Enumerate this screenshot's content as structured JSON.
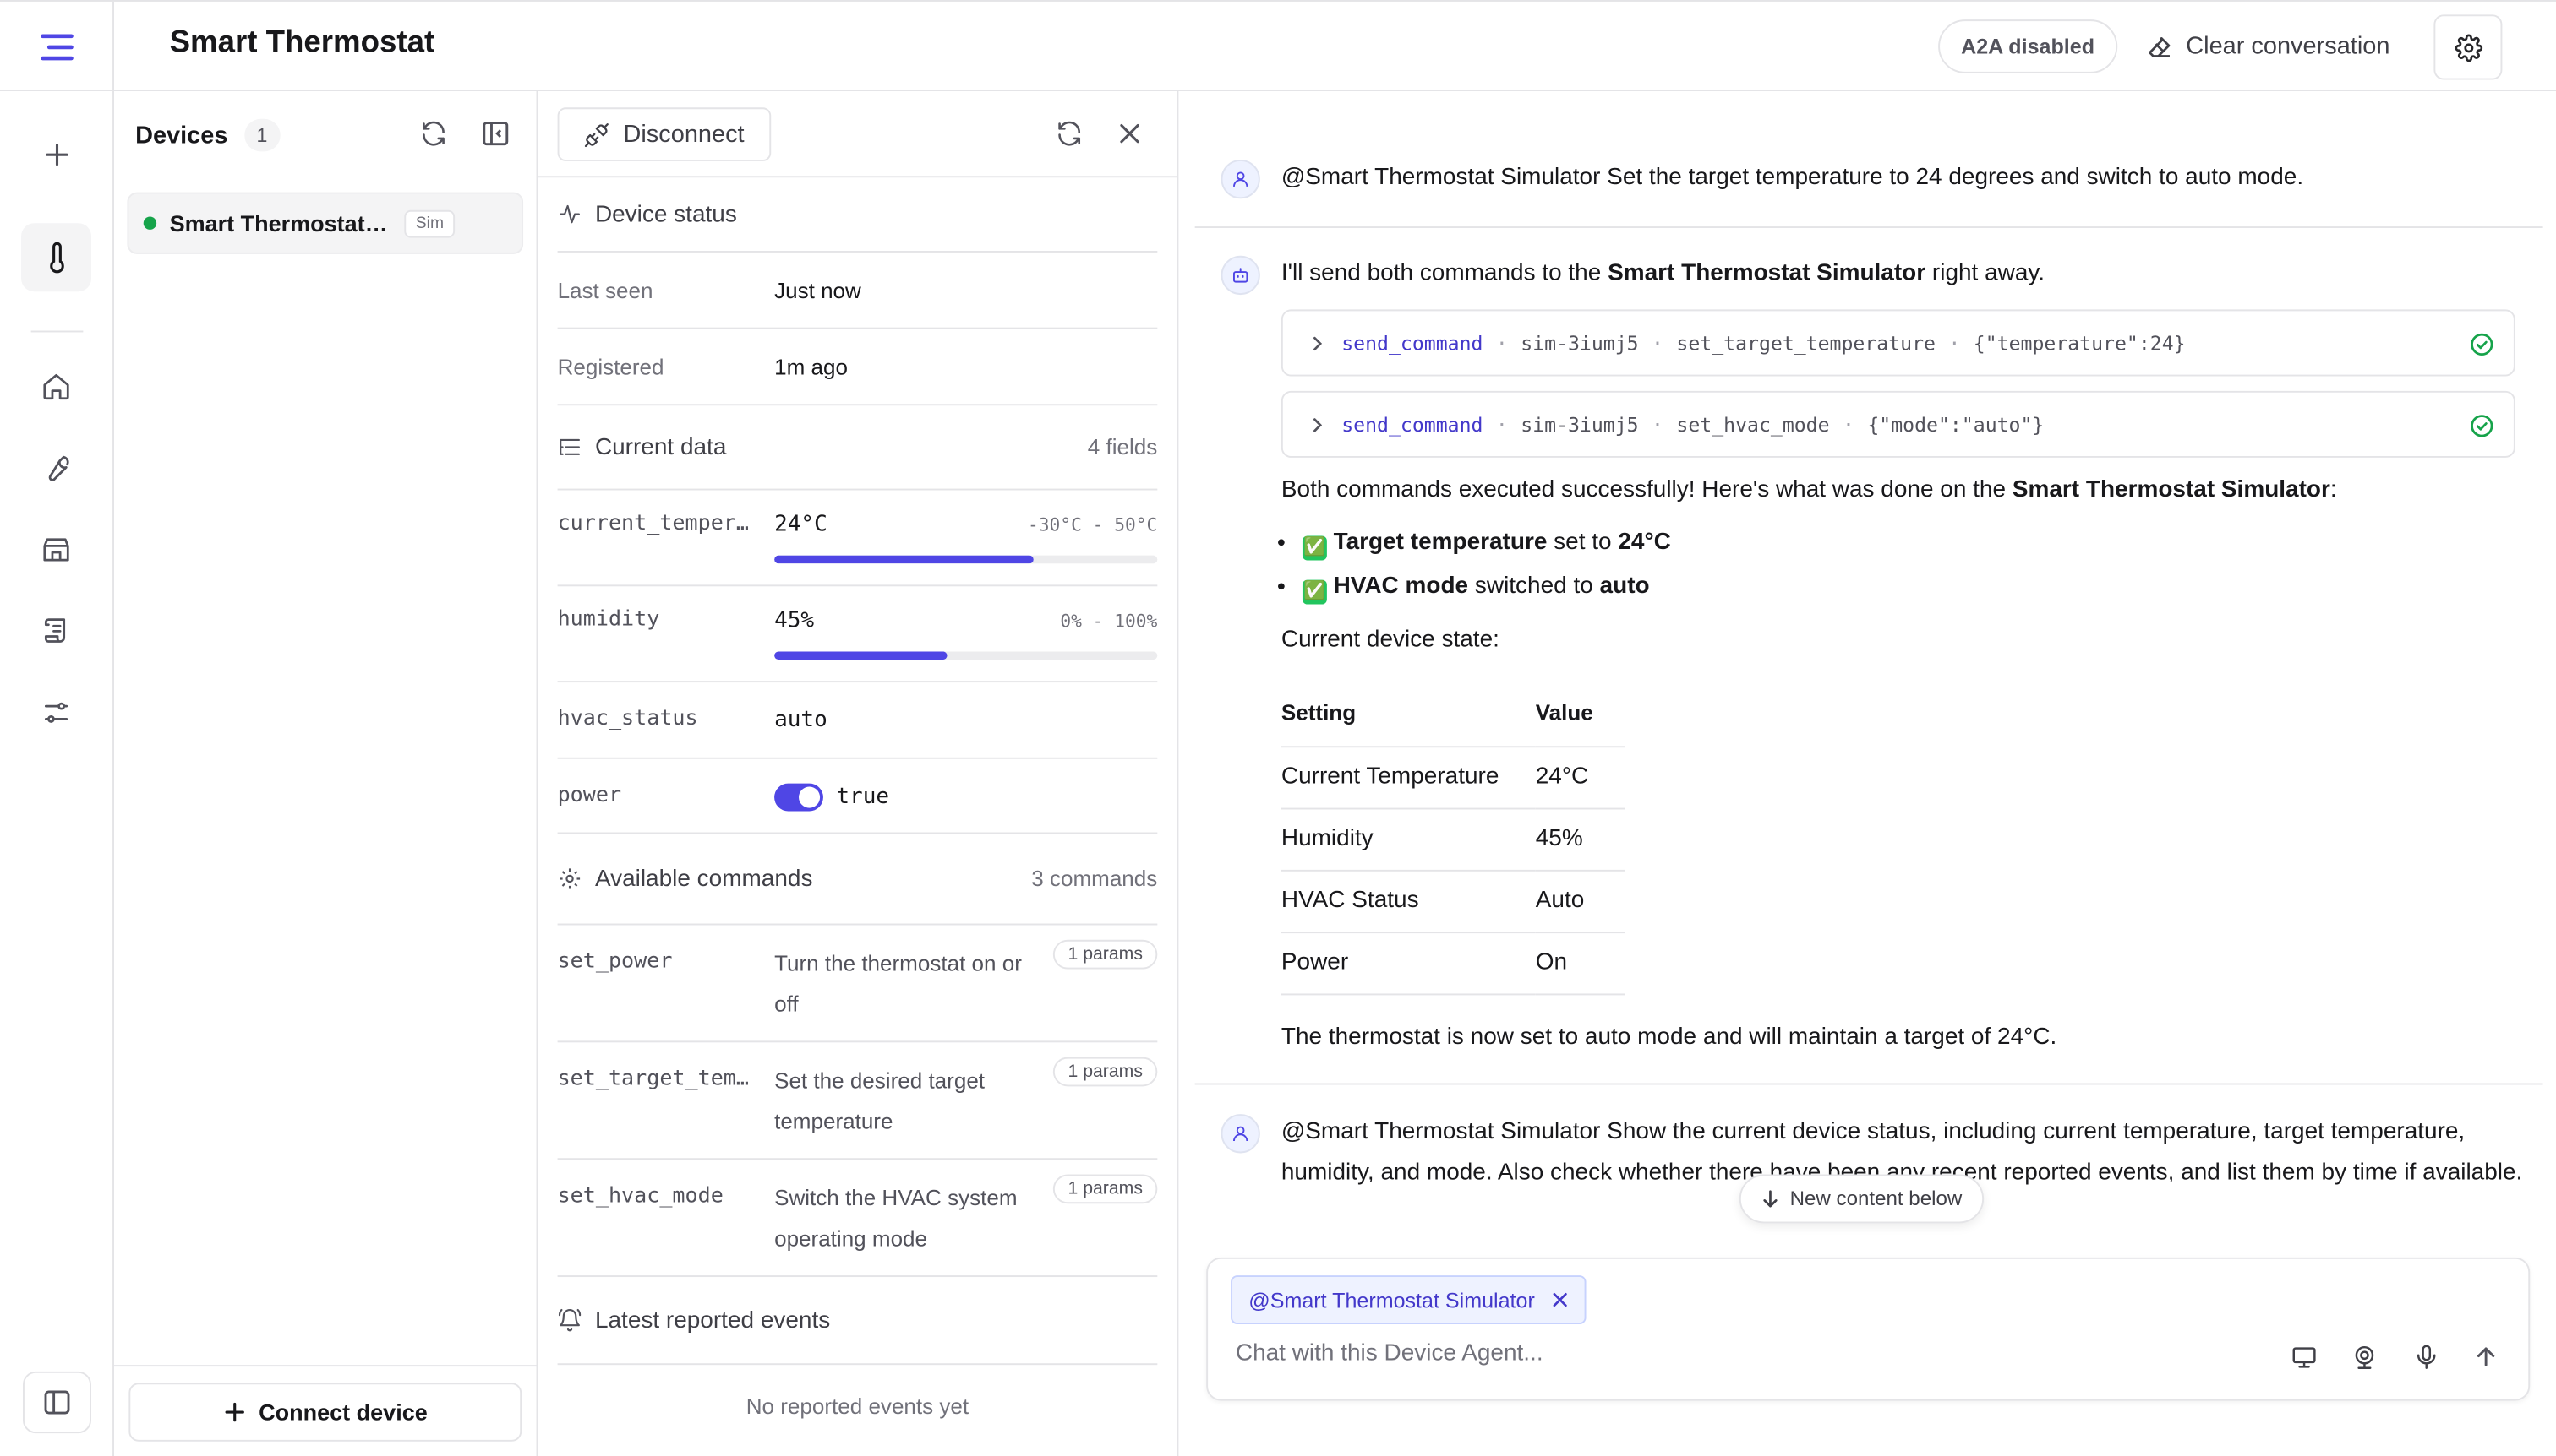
{
  "header": {
    "title": "Smart Thermostat",
    "a2a_label": "A2A disabled",
    "clear_label": "Clear conversation"
  },
  "devices_panel": {
    "title": "Devices",
    "count": "1",
    "device": {
      "name": "Smart Thermostat Simulator",
      "badge": "Sim",
      "status_color": "#16a34a"
    },
    "connect_label": "Connect device"
  },
  "detail": {
    "disconnect_label": "Disconnect",
    "device_status": {
      "title": "Device status",
      "rows": [
        {
          "label": "Last seen",
          "value": "Just now"
        },
        {
          "label": "Registered",
          "value": "1m ago"
        }
      ]
    },
    "current_data": {
      "title": "Current data",
      "meta": "4 fields",
      "fields": [
        {
          "key": "current_temperature",
          "value": "24°C",
          "range": "-30°C - 50°C",
          "level": 0.675
        },
        {
          "key": "humidity",
          "value": "45%",
          "range": "0% - 100%",
          "level": 0.45
        },
        {
          "key": "hvac_status",
          "value": "auto"
        },
        {
          "key": "power",
          "value": "true",
          "toggle_on": true
        }
      ]
    },
    "commands": {
      "title": "Available commands",
      "meta": "3 commands",
      "items": [
        {
          "name": "set_power",
          "desc": "Turn the thermostat on or off",
          "params": "1 params"
        },
        {
          "name": "set_target_temperature",
          "desc": "Set the desired target temperature",
          "params": "1 params"
        },
        {
          "name": "set_hvac_mode",
          "desc": "Switch the HVAC system operating mode",
          "params": "1 params"
        }
      ]
    },
    "events": {
      "title": "Latest reported events",
      "empty": "No reported events yet"
    }
  },
  "chat": {
    "user_msg_1": "@Smart Thermostat Simulator Set the target temperature to 24 degrees and switch to auto mode.",
    "assistant": {
      "intro_pre": "I'll send both commands to the ",
      "intro_bold": "Smart Thermostat Simulator",
      "intro_post": " right away.",
      "tool_calls": [
        {
          "fn": "send_command",
          "device": "sim-3iumj5",
          "command": "set_target_temperature",
          "args": "{\"temperature\":24}"
        },
        {
          "fn": "send_command",
          "device": "sim-3iumj5",
          "command": "set_hvac_mode",
          "args": "{\"mode\":\"auto\"}"
        }
      ],
      "summary_pre": "Both commands executed successfully! Here's what was done on the ",
      "summary_bold": "Smart Thermostat Simulator",
      "summary_post": ":",
      "bullets": [
        {
          "emoji": "✅",
          "bold": "Target temperature",
          "mid": " set to ",
          "val": "24°C"
        },
        {
          "emoji": "✅",
          "bold": "HVAC mode",
          "mid": " switched to ",
          "val": "auto"
        }
      ],
      "state_label": "Current device state:",
      "table": {
        "headers": [
          "Setting",
          "Value"
        ],
        "rows": [
          [
            "Current Temperature",
            "24°C"
          ],
          [
            "Humidity",
            "45%"
          ],
          [
            "HVAC Status",
            "Auto"
          ],
          [
            "Power",
            "On"
          ]
        ]
      },
      "closing": "The thermostat is now set to auto mode and will maintain a target of 24°C."
    },
    "user_msg_2": "@Smart Thermostat Simulator Show the current device status, including current temperature, target temperature, humidity, and mode. Also check whether there have been any recent reported events, and list them by time if available.",
    "new_content_label": "New content below",
    "composer": {
      "mention": "@Smart Thermostat Simulator",
      "placeholder": "Chat with this Device Agent..."
    }
  },
  "colors": {
    "accent": "#4f46e5",
    "success": "#16a34a"
  }
}
